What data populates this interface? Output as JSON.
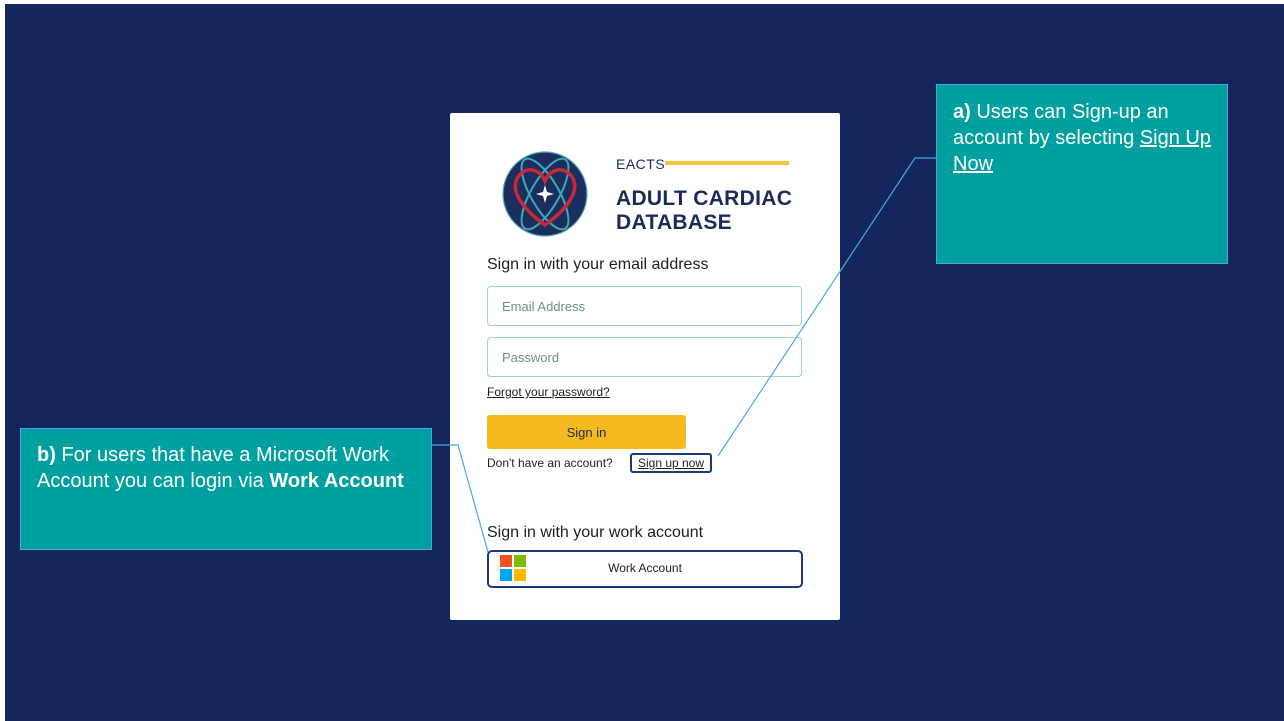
{
  "card": {
    "brand": {
      "org": "EACTS",
      "title_line1": "ADULT CARDIAC",
      "title_line2": "DATABASE"
    },
    "email_section_label": "Sign in with your email address",
    "email_placeholder": "Email Address",
    "password_placeholder": "Password",
    "forgot_link": "Forgot your password?",
    "signin_button": "Sign in",
    "no_account_text": "Don't have an account?",
    "signup_link": "Sign up now",
    "work_section_label": "Sign in with your work account",
    "work_account_button": "Work Account",
    "icons": {
      "logo": "heart-atom-logo-icon",
      "work_account": "microsoft-windows-icon"
    }
  },
  "callouts": {
    "a": {
      "prefix": "a)",
      "text": " Users can Sign-up an account by selecting ",
      "link": "Sign Up Now"
    },
    "b": {
      "prefix": "b)",
      "text": " For users that have a Microsoft Work Account you can login via ",
      "bold": "Work Account"
    }
  },
  "colors": {
    "background": "#13275c",
    "callout": "#009fa0",
    "signin_button": "#f6ba1f",
    "field_border": "#9fd2c8",
    "highlight_border": "#1b3a7a"
  }
}
